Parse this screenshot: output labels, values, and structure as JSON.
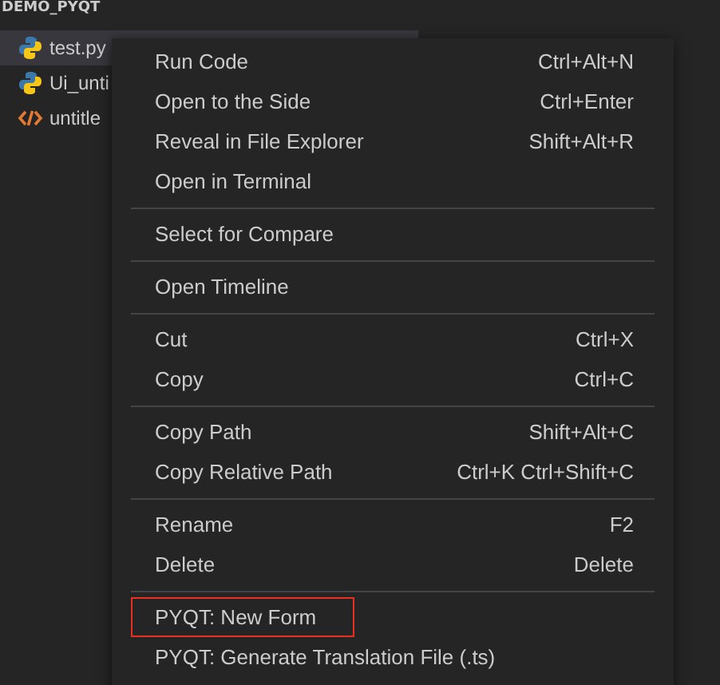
{
  "explorer": {
    "folder": "DEMO_PYQT",
    "files": [
      {
        "name": "test.py",
        "kind": "python",
        "selected": true
      },
      {
        "name": "Ui_unti",
        "kind": "python",
        "selected": false
      },
      {
        "name": "untitle",
        "kind": "html",
        "selected": false
      }
    ]
  },
  "context_menu": {
    "groups": [
      [
        {
          "label": "Run Code",
          "shortcut": "Ctrl+Alt+N"
        },
        {
          "label": "Open to the Side",
          "shortcut": "Ctrl+Enter"
        },
        {
          "label": "Reveal in File Explorer",
          "shortcut": "Shift+Alt+R"
        },
        {
          "label": "Open in Terminal"
        }
      ],
      [
        {
          "label": "Select for Compare"
        }
      ],
      [
        {
          "label": "Open Timeline"
        }
      ],
      [
        {
          "label": "Cut",
          "shortcut": "Ctrl+X"
        },
        {
          "label": "Copy",
          "shortcut": "Ctrl+C"
        }
      ],
      [
        {
          "label": "Copy Path",
          "shortcut": "Shift+Alt+C"
        },
        {
          "label": "Copy Relative Path",
          "shortcut": "Ctrl+K Ctrl+Shift+C"
        }
      ],
      [
        {
          "label": "Rename",
          "shortcut": "F2"
        },
        {
          "label": "Delete",
          "shortcut": "Delete"
        }
      ],
      [
        {
          "label": "PYQT: New Form",
          "outlined": true
        },
        {
          "label": "PYQT: Generate Translation File (.ts)",
          "outlined": false
        }
      ]
    ]
  }
}
